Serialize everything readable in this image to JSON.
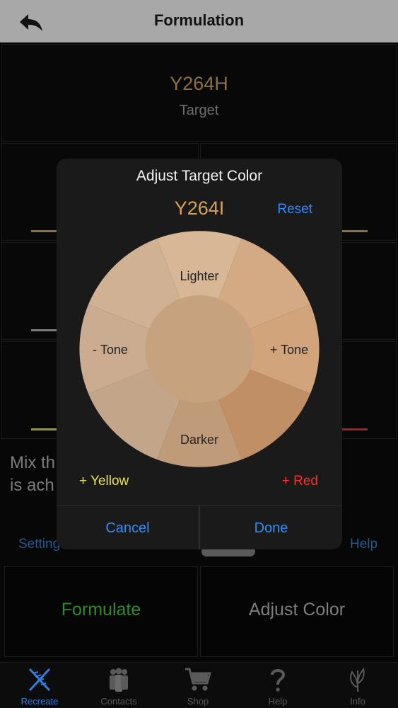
{
  "header": {
    "title": "Formulation",
    "back_icon": "back-arrow-icon"
  },
  "target": {
    "code": "Y264H",
    "label": "Target"
  },
  "background": {
    "mix_line1": "Mix th",
    "mix_line2": "is ach",
    "settings_link": "Setting",
    "help_link": "Help",
    "formulate_label": "Formulate",
    "adjust_color_label": "Adjust Color"
  },
  "dialog": {
    "title": "Adjust Target Color",
    "code": "Y264I",
    "reset_label": "Reset",
    "wheel": {
      "lighter": "Lighter",
      "darker": "Darker",
      "minus_tone": "- Tone",
      "plus_tone": "+ Tone"
    },
    "plus_yellow": "+ Yellow",
    "plus_red": "+ Red",
    "cancel_label": "Cancel",
    "done_label": "Done"
  },
  "tabs": [
    {
      "label": "Recreate",
      "icon": "dna-icon",
      "active": true
    },
    {
      "label": "Contacts",
      "icon": "people-icon",
      "active": false
    },
    {
      "label": "Shop",
      "icon": "cart-icon",
      "active": false
    },
    {
      "label": "Help",
      "icon": "question-icon",
      "active": false
    },
    {
      "label": "Info",
      "icon": "leaf-icon",
      "active": false
    }
  ],
  "colors": {
    "accent_blue": "#2f8cff",
    "target_gold": "#d6a25a",
    "formulate_green": "#2f8a2f",
    "active_tab": "#2f7fe0",
    "wheel_center": "#c7a27f",
    "wheel_lighter": "#d7b796",
    "wheel_darker": "#c09b79",
    "wheel_tone_minus": "#cbac90",
    "wheel_tone_plus": "#d2a47c",
    "wheel_yellow": "#c3a58a",
    "wheel_red": "#c08f66"
  }
}
